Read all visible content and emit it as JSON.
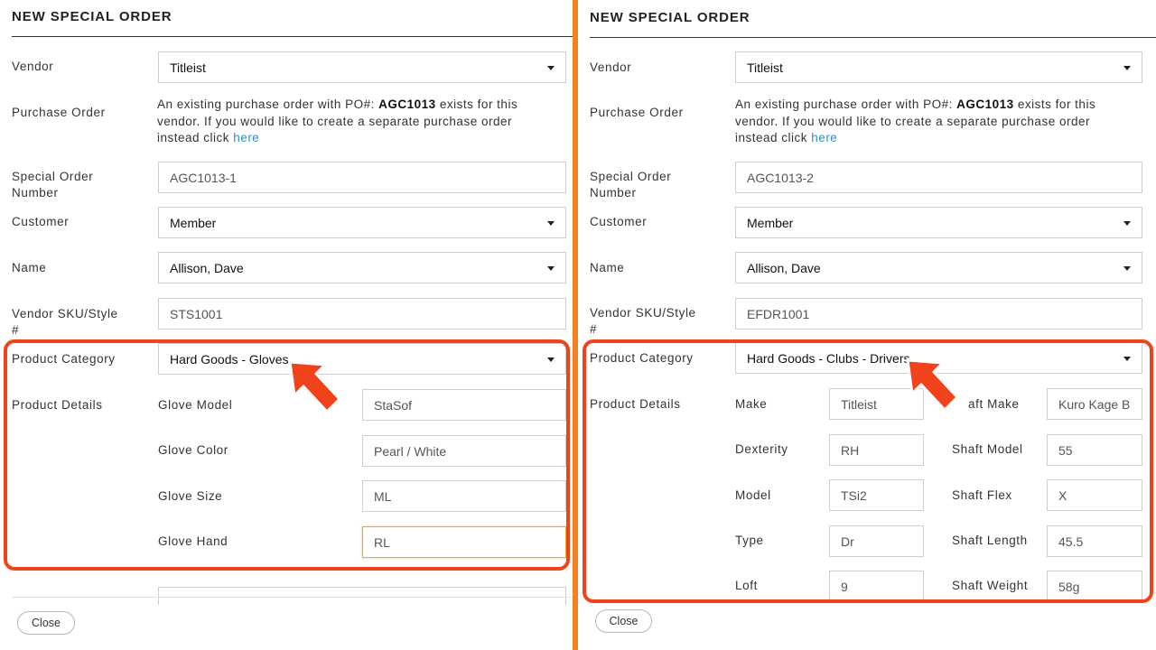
{
  "colors": {
    "divider": "#f58220",
    "highlight": "#f0421b",
    "link": "#2a8fc7",
    "focus_border": "#f5a623"
  },
  "left": {
    "title": "NEW SPECIAL ORDER",
    "vendor_label": "Vendor",
    "vendor_value": "Titleist",
    "po_label": "Purchase Order",
    "po_text_1": "An existing purchase order with PO#: ",
    "po_number": "AGC1013",
    "po_text_2": " exists for this vendor. If you would like to create a separate purchase order instead click ",
    "po_link": "here",
    "special_order_label_1": "Special Order",
    "special_order_label_2": "Number",
    "special_order_value": "AGC1013-1",
    "customer_label": "Customer",
    "customer_value": "Member",
    "name_label": "Name",
    "name_value": "Allison, Dave",
    "sku_label_1": "Vendor SKU/Style",
    "sku_label_2": "#",
    "sku_value": "STS1001",
    "category_label": "Product Category",
    "category_value": "Hard Goods - Gloves",
    "details_label": "Product Details",
    "details": [
      {
        "label": "Glove Model",
        "value": "StaSof"
      },
      {
        "label": "Glove Color",
        "value": "Pearl / White"
      },
      {
        "label": "Glove Size",
        "value": "ML"
      },
      {
        "label": "Glove Hand",
        "value": "RL"
      }
    ],
    "close_label": "Close"
  },
  "right": {
    "title": "NEW SPECIAL ORDER",
    "vendor_label": "Vendor",
    "vendor_value": "Titleist",
    "po_label": "Purchase Order",
    "po_text_1": "An existing purchase order with PO#: ",
    "po_number": "AGC1013",
    "po_text_2": " exists for this vendor. If you would like to create a separate purchase order instead click ",
    "po_link": "here",
    "special_order_label_1": "Special Order",
    "special_order_label_2": "Number",
    "special_order_value": "AGC1013-2",
    "customer_label": "Customer",
    "customer_value": "Member",
    "name_label": "Name",
    "name_value": "Allison, Dave",
    "sku_label_1": "Vendor SKU/Style",
    "sku_label_2": "#",
    "sku_value": "EFDR1001",
    "category_label": "Product Category",
    "category_value": "Hard Goods - Clubs - Drivers",
    "details_label": "Product Details",
    "details_col1": [
      {
        "label": "Make",
        "value": "Titleist"
      },
      {
        "label": "Dexterity",
        "value": "RH"
      },
      {
        "label": "Model",
        "value": "TSi2"
      },
      {
        "label": "Type",
        "value": "Dr"
      },
      {
        "label": "Loft",
        "value": "9"
      }
    ],
    "details_col2": [
      {
        "label": "aft Make",
        "value": "Kuro Kage B"
      },
      {
        "label": "Shaft Model",
        "value": "55"
      },
      {
        "label": "Shaft Flex",
        "value": "X"
      },
      {
        "label": "Shaft Length",
        "value": "45.5"
      },
      {
        "label": "Shaft Weight",
        "value": "58g"
      }
    ],
    "close_label": "Close"
  }
}
